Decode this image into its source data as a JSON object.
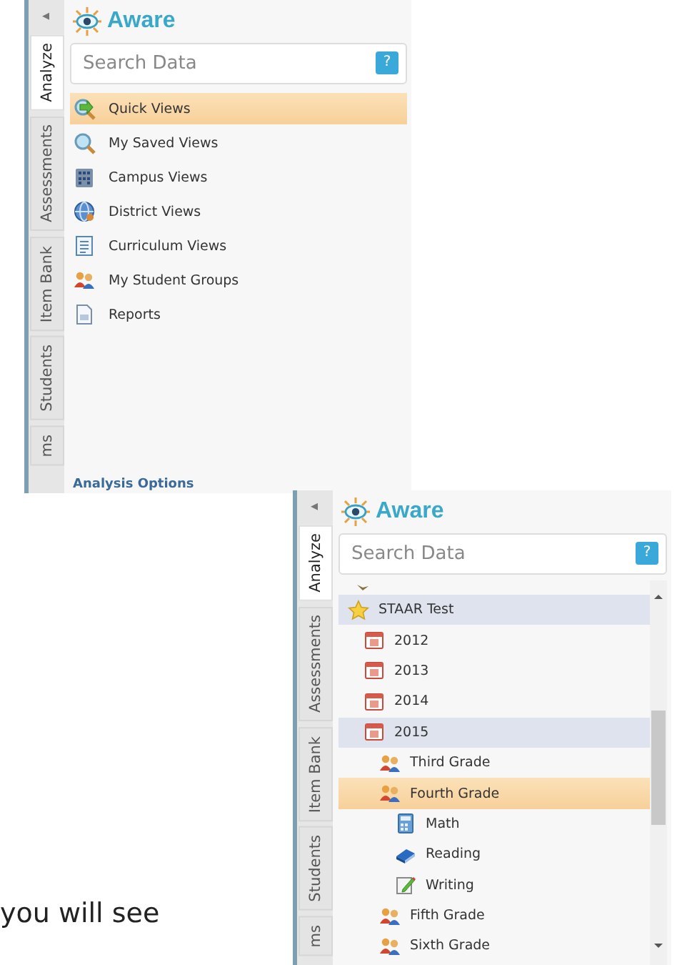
{
  "panels": [
    {
      "collapse_arrow": "◂",
      "tabs": [
        {
          "label": "Analyze",
          "selected": true
        },
        {
          "label": "Assessments",
          "selected": false
        },
        {
          "label": "Item Bank",
          "selected": false
        },
        {
          "label": "Students",
          "selected": false
        },
        {
          "label": "ms",
          "selected": false
        }
      ],
      "logo": "Aware",
      "search": {
        "placeholder": "Search Data",
        "help_button": "?"
      },
      "nav_items": [
        {
          "kind": "quick",
          "label": "Quick Views",
          "selected": true
        },
        {
          "kind": "magnifier",
          "label": "My Saved Views",
          "selected": false
        },
        {
          "kind": "building",
          "label": "Campus Views",
          "selected": false
        },
        {
          "kind": "globe",
          "label": "District Views",
          "selected": false
        },
        {
          "kind": "document",
          "label": "Curriculum Views",
          "selected": false
        },
        {
          "kind": "group",
          "label": "My Student Groups",
          "selected": false
        },
        {
          "kind": "report",
          "label": "Reports",
          "selected": false
        }
      ],
      "footer": "Analysis Options"
    },
    {
      "collapse_arrow": "◂",
      "tabs": [
        {
          "label": "Analyze",
          "selected": true
        },
        {
          "label": "Assessments",
          "selected": false
        },
        {
          "label": "Item Bank",
          "selected": false
        },
        {
          "label": "Students",
          "selected": false
        },
        {
          "label": "ms",
          "selected": false
        }
      ],
      "logo": "Aware",
      "search": {
        "placeholder": "Search Data",
        "help_button": "?"
      },
      "tree": [
        {
          "kind": "star",
          "label": "STAAR Test",
          "highlighted": true,
          "selected": false,
          "children": [
            {
              "kind": "calendar",
              "label": "2012",
              "highlighted": false,
              "selected": false
            },
            {
              "kind": "calendar",
              "label": "2013",
              "highlighted": false,
              "selected": false
            },
            {
              "kind": "calendar",
              "label": "2014",
              "highlighted": false,
              "selected": false
            },
            {
              "kind": "calendar",
              "label": "2015",
              "highlighted": true,
              "selected": false,
              "children": [
                {
                  "kind": "group",
                  "label": "Third Grade",
                  "highlighted": false,
                  "selected": false
                },
                {
                  "kind": "group",
                  "label": "Fourth Grade",
                  "highlighted": false,
                  "selected": true,
                  "children": [
                    {
                      "kind": "calculator",
                      "label": "Math",
                      "highlighted": false,
                      "selected": false
                    },
                    {
                      "kind": "book",
                      "label": "Reading",
                      "highlighted": false,
                      "selected": false
                    },
                    {
                      "kind": "pencil",
                      "label": "Writing",
                      "highlighted": false,
                      "selected": false
                    }
                  ]
                },
                {
                  "kind": "group",
                  "label": "Fifth Grade",
                  "highlighted": false,
                  "selected": false
                },
                {
                  "kind": "group",
                  "label": "Sixth Grade",
                  "highlighted": false,
                  "selected": false
                }
              ]
            }
          ]
        }
      ]
    }
  ],
  "caption": "you will see"
}
